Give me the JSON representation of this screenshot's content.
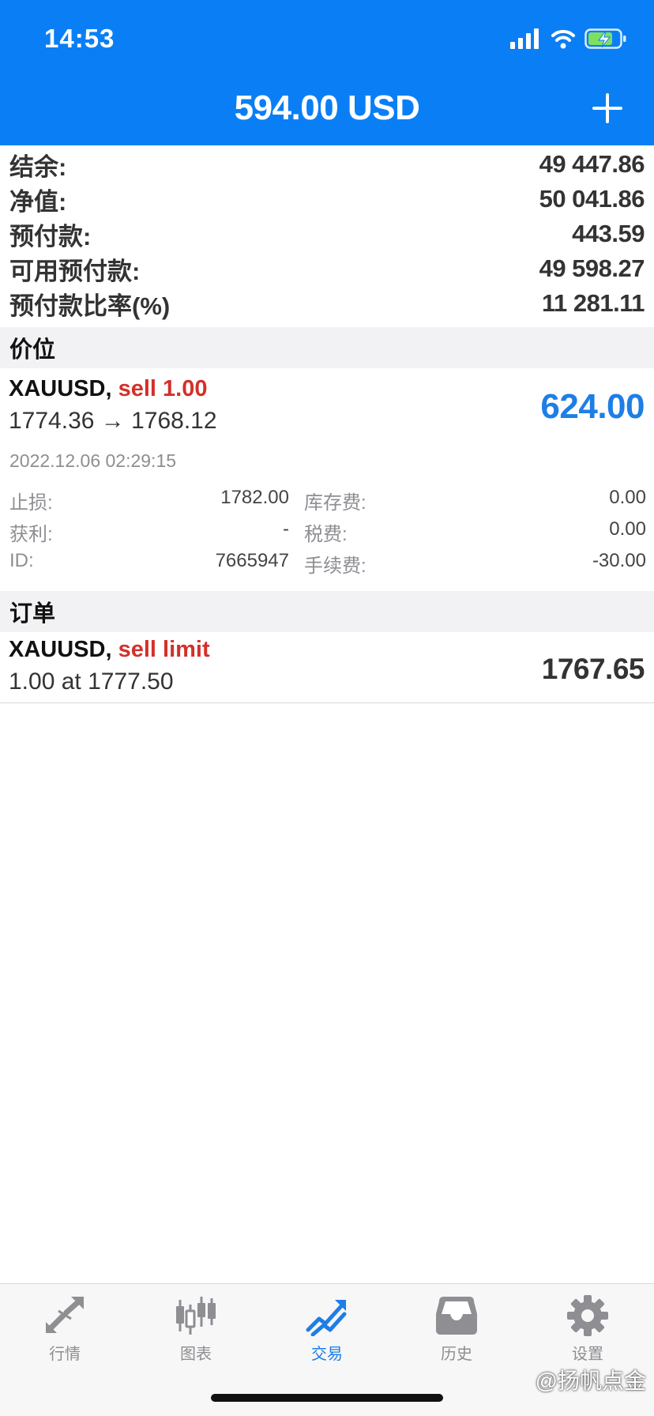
{
  "status_bar": {
    "time": "14:53"
  },
  "nav": {
    "title": "594.00 USD"
  },
  "account": [
    {
      "label": "结余:",
      "value": "49 447.86"
    },
    {
      "label": "净值:",
      "value": "50 041.86"
    },
    {
      "label": "预付款:",
      "value": "443.59"
    },
    {
      "label": "可用预付款:",
      "value": "49 598.27"
    },
    {
      "label": "预付款比率(%)",
      "value": "11 281.11"
    }
  ],
  "sections": {
    "positions": "价位",
    "orders": "订单"
  },
  "position": {
    "symbol": "XAUUSD,",
    "side": "sell 1.00",
    "prices": "1774.36 → 1768.12",
    "profit": "624.00",
    "time": "2022.12.06 02:29:15",
    "details": [
      {
        "label_left": "止损:",
        "value_left": "1782.00",
        "label_right": "库存费:",
        "value_right": "0.00"
      },
      {
        "label_left": "获利:",
        "value_left": "-",
        "label_right": "税费:",
        "value_right": "0.00"
      },
      {
        "label_left": "ID:",
        "value_left": "7665947",
        "label_right": "手续费:",
        "value_right": "-30.00"
      }
    ]
  },
  "order": {
    "symbol": "XAUUSD,",
    "type": "sell limit",
    "desc": "1.00 at 1777.50",
    "price": "1767.65"
  },
  "tabs": [
    {
      "label": "行情",
      "icon": "quotes-arrows-icon",
      "active": false
    },
    {
      "label": "图表",
      "icon": "candlestick-chart-icon",
      "active": false
    },
    {
      "label": "交易",
      "icon": "trade-trend-icon",
      "active": true
    },
    {
      "label": "历史",
      "icon": "history-inbox-icon",
      "active": false
    },
    {
      "label": "设置",
      "icon": "gear-icon",
      "active": false
    }
  ],
  "watermark": "@扬帆点金",
  "colors": {
    "accent": "#0a7ff5",
    "profit_blue": "#1e7ee6",
    "sell_red": "#d3302a",
    "inactive": "#8e8e93"
  }
}
